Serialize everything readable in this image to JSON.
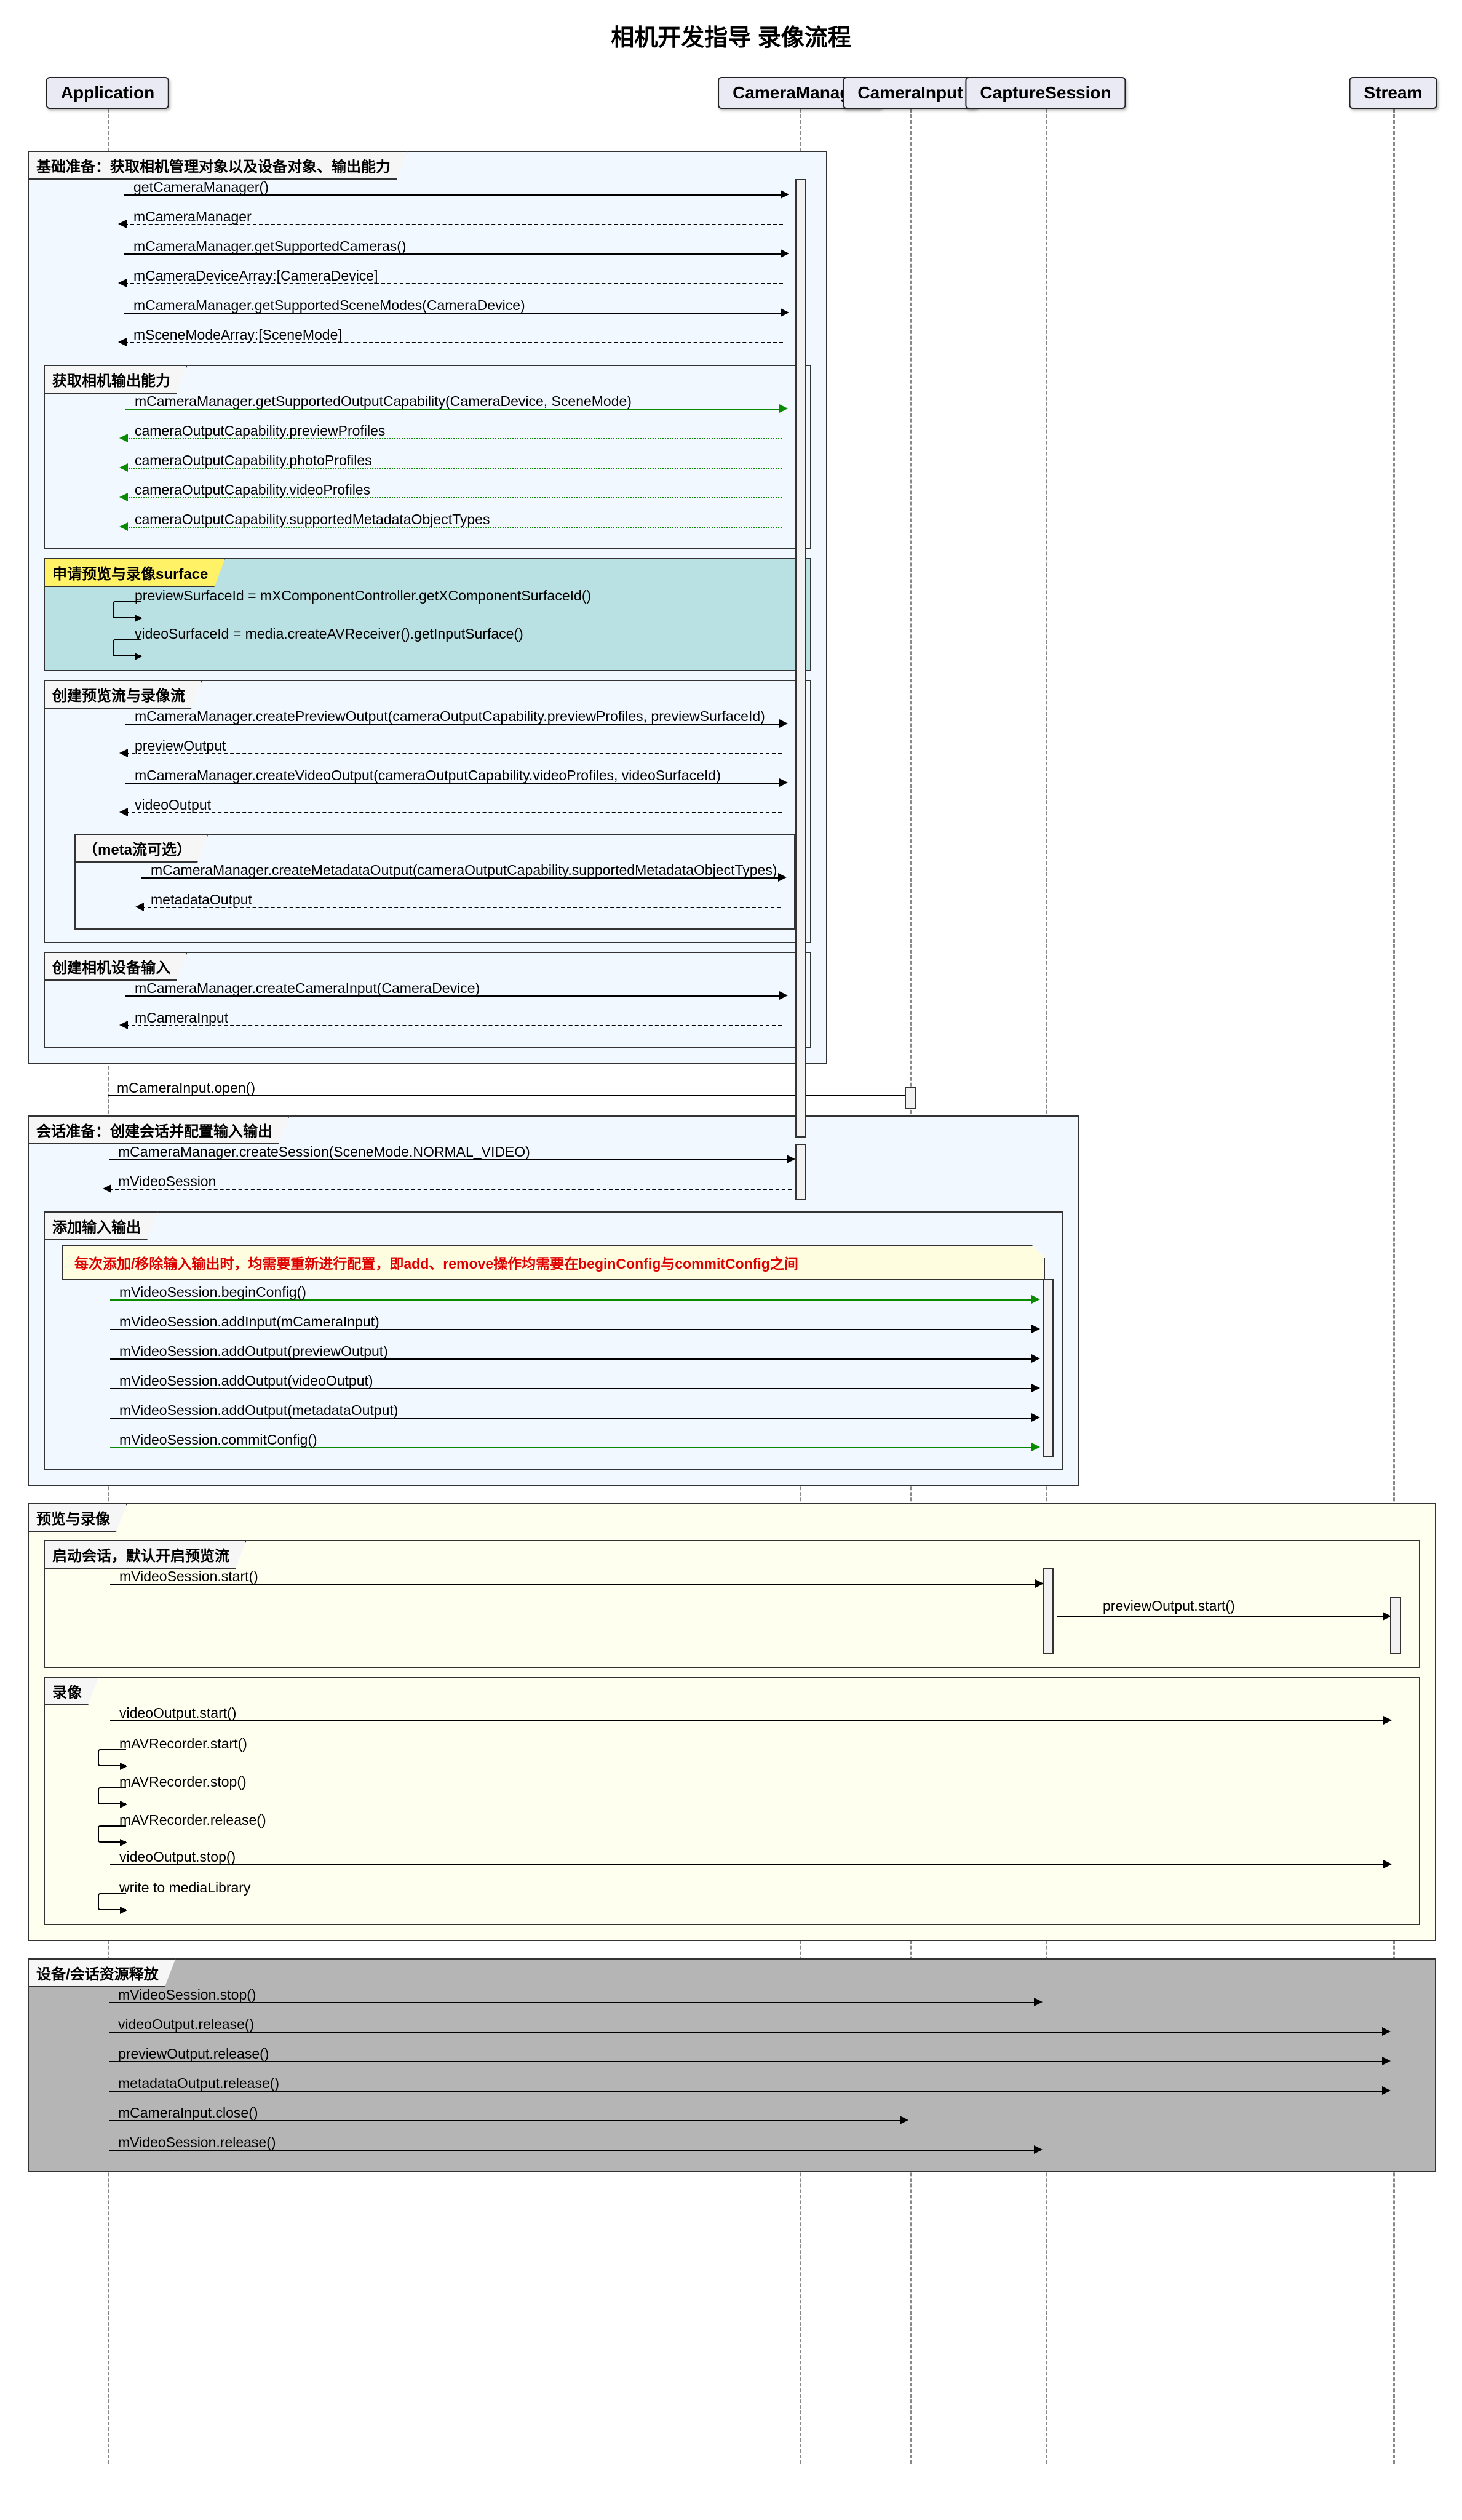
{
  "title": "相机开发指导 录像流程",
  "participants": {
    "app": "Application",
    "cm": "CameraManager",
    "ci": "CameraInput",
    "cs": "CaptureSession",
    "st": "Stream"
  },
  "groups": {
    "g1": "基础准备：获取相机管理对象以及设备对象、输出能力",
    "g1a": "获取相机输出能力",
    "g1b": "申请预览与录像surface",
    "g1c": "创建预览流与录像流",
    "g1c1": "（meta流可选）",
    "g1d": "创建相机设备输入",
    "g2": "会话准备：创建会话并配置输入输出",
    "g2a": "添加输入输出",
    "g3": "预览与录像",
    "g3a": "启动会话，默认开启预览流",
    "g3b": "录像",
    "g4": "设备/会话资源释放"
  },
  "note1": "每次添加/移除输入输出时，均需要重新进行配置，即add、remove操作均需要在beginConfig与commitConfig之间",
  "msgs": {
    "m1": "getCameraManager()",
    "m2": "mCameraManager",
    "m3": "mCameraManager.getSupportedCameras()",
    "m4": "mCameraDeviceArray:[CameraDevice]",
    "m5": "mCameraManager.getSupportedSceneModes(CameraDevice)",
    "m6": "mSceneModeArray:[SceneMode]",
    "m7": "mCameraManager.getSupportedOutputCapability(CameraDevice, SceneMode)",
    "m8": "cameraOutputCapability.previewProfiles",
    "m9": "cameraOutputCapability.photoProfiles",
    "m10": "cameraOutputCapability.videoProfiles",
    "m11": "cameraOutputCapability.supportedMetadataObjectTypes",
    "m12": "previewSurfaceId = mXComponentController.getXComponentSurfaceId()",
    "m13": "videoSurfaceId = media.createAVReceiver().getInputSurface()",
    "m14": "mCameraManager.createPreviewOutput(cameraOutputCapability.previewProfiles, previewSurfaceId)",
    "m15": "previewOutput",
    "m16": "mCameraManager.createVideoOutput(cameraOutputCapability.videoProfiles, videoSurfaceId)",
    "m17": "videoOutput",
    "m18": "mCameraManager.createMetadataOutput(cameraOutputCapability.supportedMetadataObjectTypes)",
    "m19": "metadataOutput",
    "m20": "mCameraManager.createCameraInput(CameraDevice)",
    "m21": "mCameraInput",
    "m22": "mCameraInput.open()",
    "m23": "mCameraManager.createSession(SceneMode.NORMAL_VIDEO)",
    "m24": "mVideoSession",
    "m25": "mVideoSession.beginConfig()",
    "m26": "mVideoSession.addInput(mCameraInput)",
    "m27": "mVideoSession.addOutput(previewOutput)",
    "m28": "mVideoSession.addOutput(videoOutput)",
    "m29": "mVideoSession.addOutput(metadataOutput)",
    "m30": "mVideoSession.commitConfig()",
    "m31": "mVideoSession.start()",
    "m32": "previewOutput.start()",
    "m33": "videoOutput.start()",
    "m34": "mAVRecorder.start()",
    "m35": "mAVRecorder.stop()",
    "m36": "mAVRecorder.release()",
    "m37": "videoOutput.stop()",
    "m38": "write to mediaLibrary",
    "m39": "mVideoSession.stop()",
    "m40": "videoOutput.release()",
    "m41": "previewOutput.release()",
    "m42": "metadataOutput.release()",
    "m43": "mCameraInput.close()",
    "m44": "mVideoSession.release()"
  }
}
